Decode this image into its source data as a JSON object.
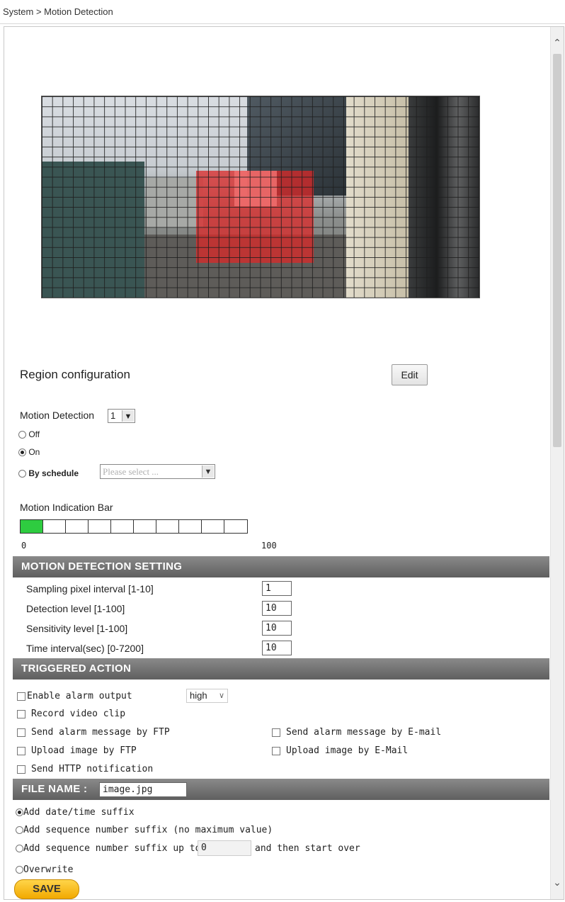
{
  "breadcrumb": "System > Motion Detection",
  "region": {
    "label": "Region configuration",
    "edit_button": "Edit"
  },
  "motion_detection": {
    "label": "Motion Detection",
    "selected": "1",
    "options": {
      "off": "Off",
      "on": "On",
      "schedule": "By schedule"
    },
    "mode": "on",
    "schedule_placeholder": "Please select ..."
  },
  "indication_bar": {
    "label": "Motion Indication Bar",
    "min": "0",
    "max": "100",
    "level_fraction": 0.1,
    "cells": 10
  },
  "motion_setting": {
    "title": "MOTION DETECTION SETTING",
    "rows": [
      {
        "label": "Sampling pixel interval [1-10]",
        "value": "1"
      },
      {
        "label": "Detection level [1-100]",
        "value": "10"
      },
      {
        "label": "Sensitivity level [1-100]",
        "value": "10"
      },
      {
        "label": "Time interval(sec) [0-7200]",
        "value": "10"
      }
    ]
  },
  "triggered_action": {
    "title": "TRIGGERED ACTION",
    "enable_alarm": "Enable alarm output",
    "alarm_level": "high",
    "record_video": "Record video clip",
    "ftp_message": "Send alarm message by FTP",
    "email_message": "Send alarm message by E-mail",
    "upload_ftp": "Upload image by FTP",
    "upload_email": "Upload image by E-Mail",
    "http_notify": "Send HTTP notification"
  },
  "file_name": {
    "title": "FILE NAME :",
    "value": "image.jpg",
    "opt_datetime": "Add date/time suffix",
    "opt_sequence": "Add sequence number suffix (no maximum value)",
    "opt_seq_upto": "Add sequence number suffix up to",
    "upto_value": "0",
    "opt_seq_upto_after": "and then start over",
    "opt_overwrite": "Overwrite"
  },
  "save_button": "SAVE",
  "colors": {
    "section_bar": "#6f6f6f",
    "motion_region": "#dc2828",
    "indicator": "#2ecc40",
    "save_button": "#f7c21a"
  }
}
